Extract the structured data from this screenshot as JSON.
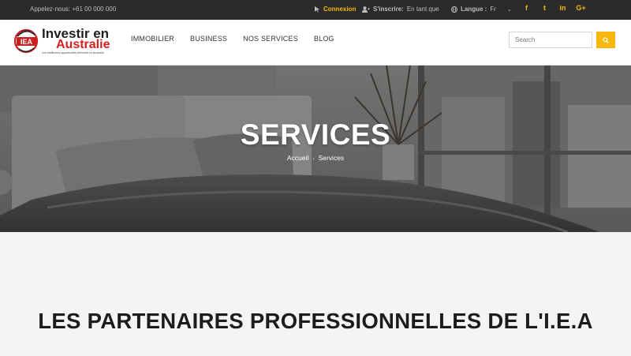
{
  "topbar": {
    "phone": "Appelez-nous: +61 00 000 000",
    "login_label": "Connexion",
    "register_label": "S'inscrire:",
    "register_value": "En tant que",
    "language_label": "Langue :",
    "language_value": "Fr",
    "social": [
      "f",
      "t",
      "in",
      "G+"
    ],
    "accent_color": "#f5b80b"
  },
  "logo": {
    "seal_text": "IEA",
    "line1": "Investir en",
    "line2": "Australie",
    "tagline": "Les meilleures opportunités d'investir en Australie"
  },
  "nav": {
    "items": [
      "IMMOBILIER",
      "BUSINESS",
      "NOS SERVICES",
      "BLOG"
    ]
  },
  "search": {
    "placeholder": "Search"
  },
  "hero": {
    "title": "SERVICES",
    "breadcrumb": [
      "Accueil",
      "Services"
    ]
  },
  "content": {
    "heading": "LES PARTENAIRES PROFESSIONNELLES DE L'I.E.A"
  }
}
